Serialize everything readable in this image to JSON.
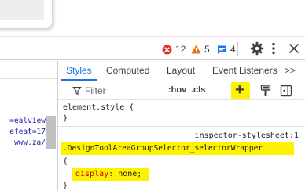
{
  "toolbar": {
    "errors": "12",
    "warnings": "5",
    "info": "4"
  },
  "left_pane": {
    "lines": [
      "ealview=",
      "efeat=17",
      "/www.za"
    ]
  },
  "tabs": {
    "styles": "Styles",
    "computed": "Computed",
    "layout": "Layout",
    "event_listeners": "Event Listeners",
    "overflow": ">>"
  },
  "filter": {
    "placeholder": "Filter",
    "hov": ":hov",
    "cls": ".cls",
    "new_rule": "+"
  },
  "rules": {
    "element_style": {
      "selector": "element.style {",
      "close": "}"
    },
    "wrapper": {
      "source": "inspector-stylesheet:1",
      "selector": ".DesignToolAreaGroupSelector_selectorWrapper",
      "open": "{",
      "property": "display",
      "colon": ":",
      "value": "none;",
      "close": "}"
    }
  },
  "colors": {
    "accent": "#1a73e8",
    "highlight": "#fff200",
    "error": "#d93025",
    "warning": "#e8710a",
    "info": "#1a73e8",
    "property": "#c80000"
  }
}
